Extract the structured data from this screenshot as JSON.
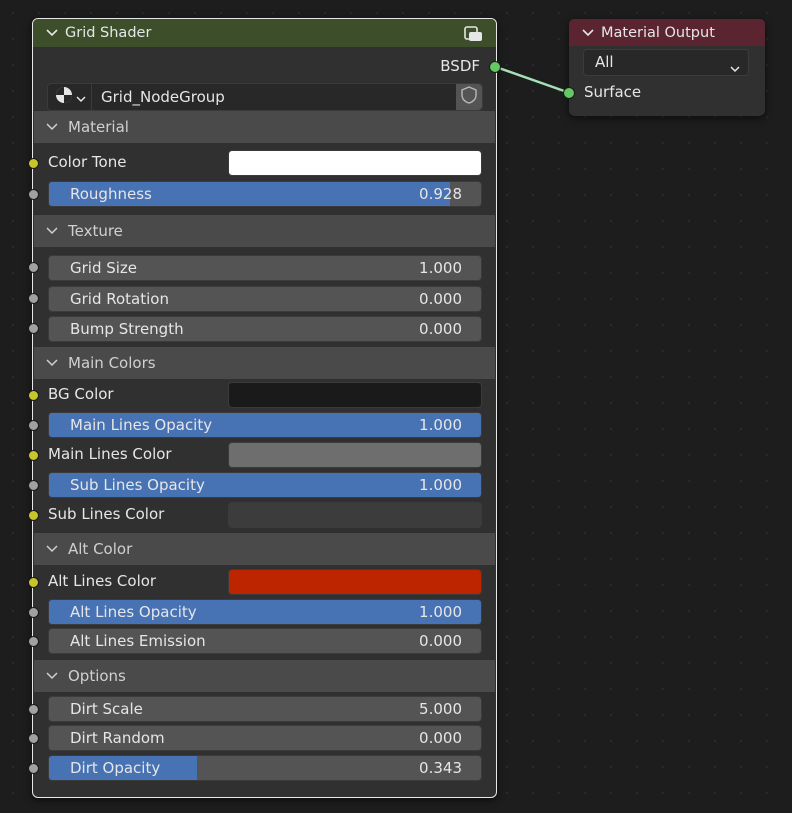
{
  "grid_node": {
    "title": "Grid Shader",
    "output_label": "BSDF",
    "node_group_name": "Grid_NodeGroup",
    "panels": {
      "material": {
        "title": "Material",
        "color_tone_label": "Color Tone",
        "color_tone_color": "#ffffff",
        "roughness_label": "Roughness",
        "roughness_value": "0.928",
        "roughness_fraction": 0.928
      },
      "texture": {
        "title": "Texture",
        "grid_size_label": "Grid Size",
        "grid_size_value": "1.000",
        "grid_rotation_label": "Grid Rotation",
        "grid_rotation_value": "0.000",
        "bump_strength_label": "Bump Strength",
        "bump_strength_value": "0.000"
      },
      "main_colors": {
        "title": "Main Colors",
        "bg_color_label": "BG Color",
        "bg_color_color": "#1a1a1a",
        "main_lines_opacity_label": "Main Lines Opacity",
        "main_lines_opacity_value": "1.000",
        "main_lines_opacity_fraction": 1.0,
        "main_lines_color_label": "Main Lines Color",
        "main_lines_color_color": "#6e6e6e",
        "sub_lines_opacity_label": "Sub Lines Opacity",
        "sub_lines_opacity_value": "1.000",
        "sub_lines_opacity_fraction": 1.0,
        "sub_lines_color_label": "Sub Lines Color",
        "sub_lines_color_color": "#3c3c3c"
      },
      "alt_color": {
        "title": "Alt Color",
        "alt_lines_color_label": "Alt Lines Color",
        "alt_lines_color_color": "#bd2500",
        "alt_lines_opacity_label": "Alt Lines Opacity",
        "alt_lines_opacity_value": "1.000",
        "alt_lines_opacity_fraction": 1.0,
        "alt_lines_emission_label": "Alt Lines Emission",
        "alt_lines_emission_value": "0.000"
      },
      "options": {
        "title": "Options",
        "dirt_scale_label": "Dirt Scale",
        "dirt_scale_value": "5.000",
        "dirt_random_label": "Dirt Random",
        "dirt_random_value": "0.000",
        "dirt_opacity_label": "Dirt Opacity",
        "dirt_opacity_value": "0.343",
        "dirt_opacity_fraction": 0.343
      }
    }
  },
  "output_node": {
    "title": "Material Output",
    "target_value": "All",
    "input_label": "Surface"
  },
  "colors": {
    "grid_header": "#3d4e2b",
    "output_header": "#5a2430",
    "slider_fill": "#4772b3",
    "link": "#7fd6a0"
  },
  "icons": [
    "chevron-down-icon",
    "node-group-icon",
    "material-sphere-icon",
    "fake-user-shield-icon"
  ]
}
